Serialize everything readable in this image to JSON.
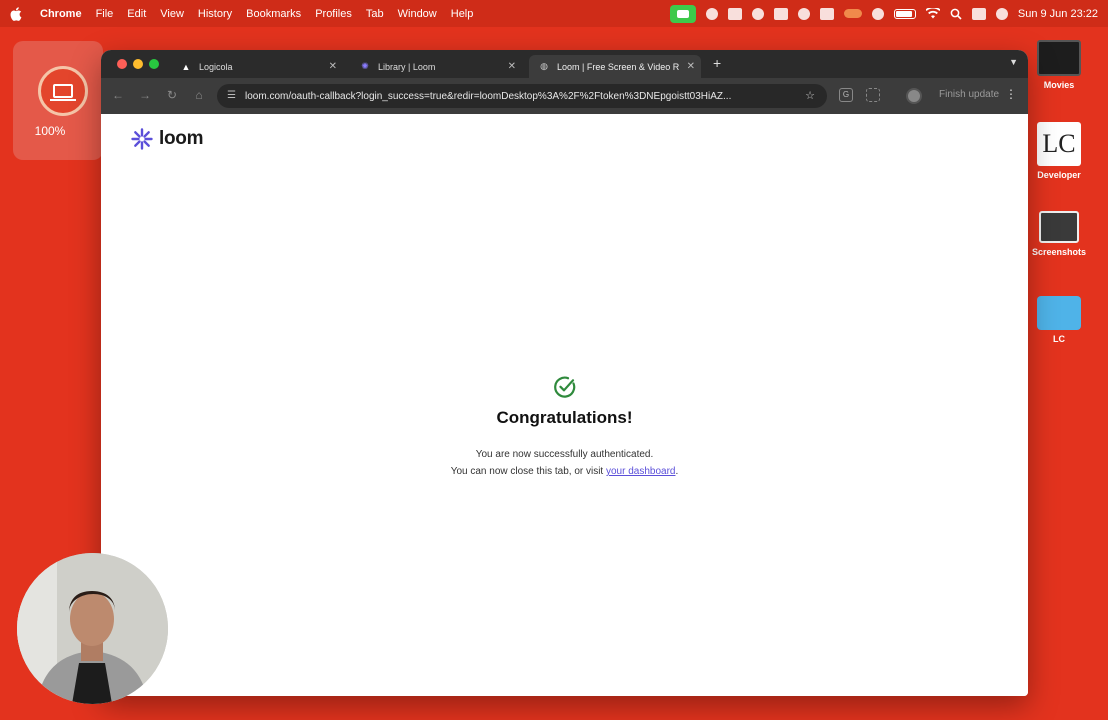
{
  "menubar": {
    "app_name": "Chrome",
    "items": [
      "File",
      "Edit",
      "View",
      "History",
      "Bookmarks",
      "Profiles",
      "Tab",
      "Window",
      "Help"
    ],
    "clock": "Sun 9 Jun  23:22"
  },
  "loom_widget": {
    "zoom": "100%"
  },
  "desktop": {
    "icons": [
      {
        "label": "Movies"
      },
      {
        "label": "Developer"
      },
      {
        "label": "Screenshots"
      },
      {
        "label": "LC"
      }
    ],
    "developer_badge": "LC"
  },
  "browser": {
    "tabs": [
      {
        "title": "Logicola",
        "icon": "logicola-icon"
      },
      {
        "title": "Library | Loom",
        "icon": "loom-icon"
      },
      {
        "title": "Loom | Free Screen & Video R",
        "icon": "globe-icon"
      }
    ],
    "url": "loom.com/oauth-callback?login_success=true&redir=loomDesktop%3A%2F%2Ftoken%3DNEpgoistt03HiAZ...",
    "finish_update": "Finish update",
    "extension_g": "G"
  },
  "page": {
    "logo_text": "loom",
    "headline": "Congratulations!",
    "line1": "You are now successfully authenticated.",
    "line2_prefix": "You can now close this tab, or visit ",
    "link_text": "your dashboard",
    "line2_suffix": "."
  },
  "colors": {
    "desktop_bg": "#e3331e",
    "loom_purple": "#5b4fd9",
    "check_green": "#2f8a3c"
  }
}
